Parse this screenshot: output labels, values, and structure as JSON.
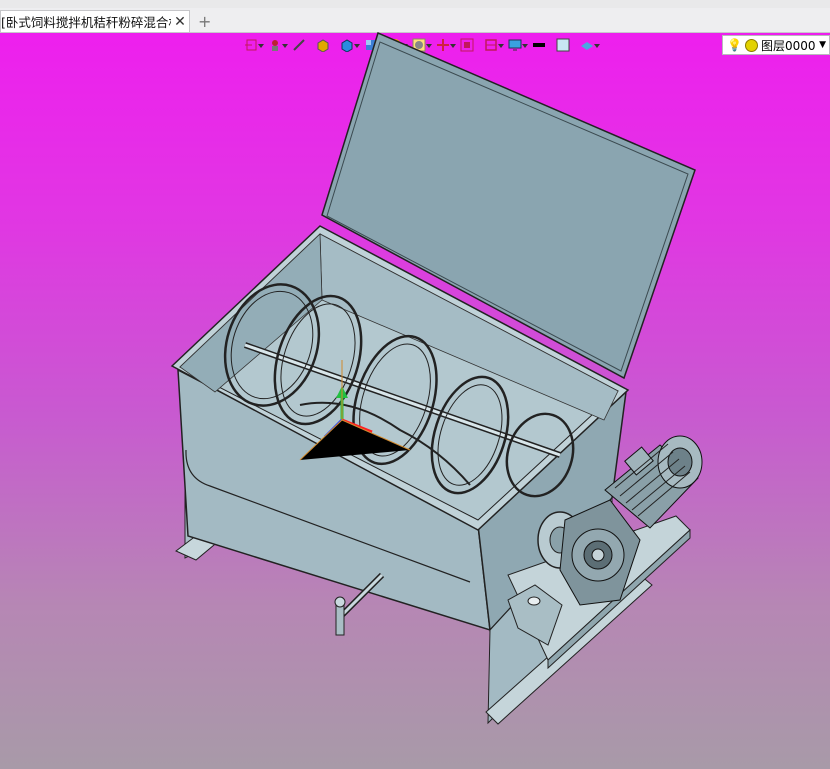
{
  "tab": {
    "title": "[卧式饲料搅拌机秸秆粉碎混合机]",
    "close_symbol": "✕"
  },
  "newtab_symbol": "+",
  "toolbar": {
    "icons": [
      "insert-icon",
      "component-icon",
      "line-icon",
      "solid-icon",
      "box-icon",
      "view-cube-icon",
      "render-icon",
      "sphere-icon",
      "move-icon",
      "fit-icon",
      "section-icon",
      "display-icon",
      "line-color-icon",
      "fill-color-icon",
      "layer-visibility-icon"
    ]
  },
  "layer": {
    "name": "图层0000"
  }
}
